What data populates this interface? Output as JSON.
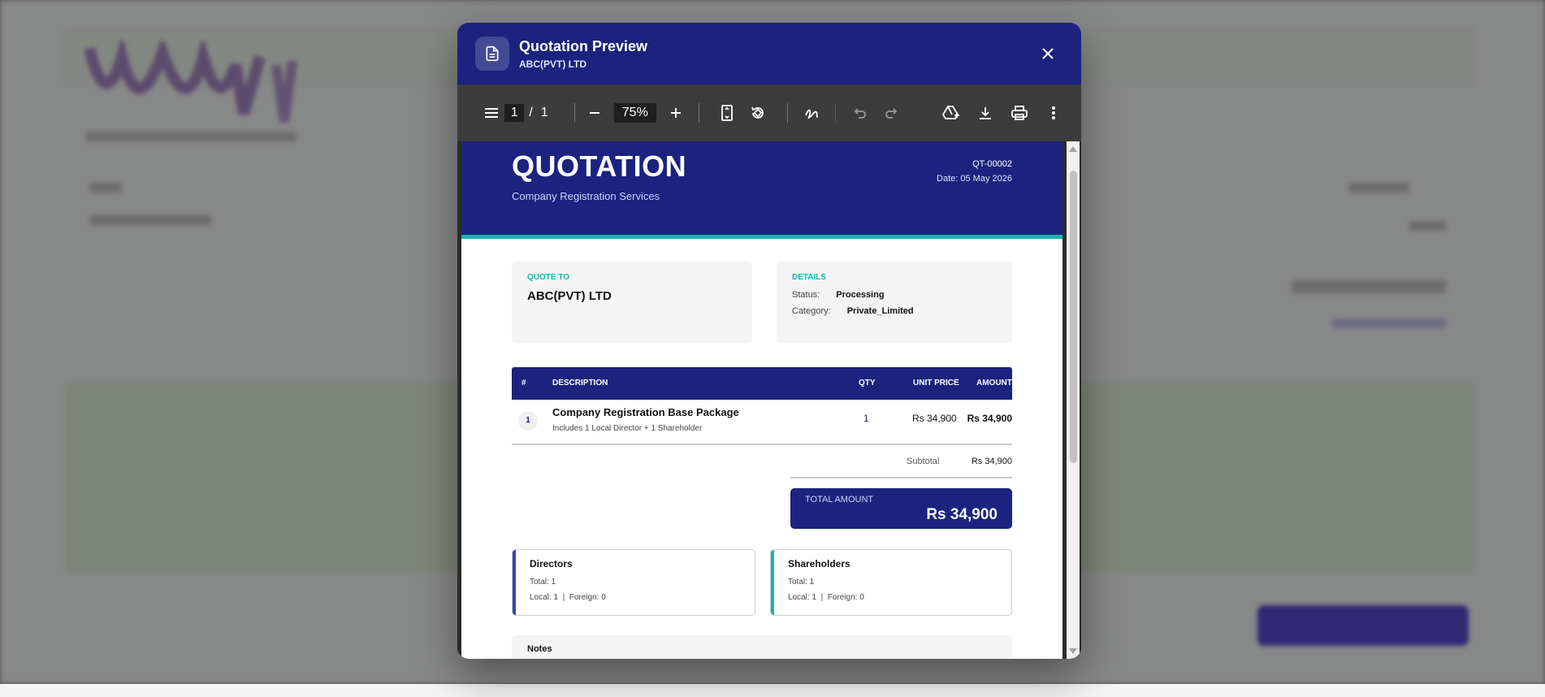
{
  "modal": {
    "title": "Quotation Preview",
    "subtitle": "ABC(PVT) LTD"
  },
  "toolbar": {
    "page_current": "1",
    "page_separator": "/",
    "page_total": "1",
    "zoom": "75%"
  },
  "document": {
    "title": "QUOTATION",
    "subtitle": "Company Registration Services",
    "number": "QT-00002",
    "date": "Date: 05 May 2026",
    "quote_to": {
      "label": "QUOTE TO",
      "company": "ABC(PVT) LTD"
    },
    "details": {
      "label": "DETAILS",
      "status_label": "Status:",
      "status_value": "Processing",
      "category_label": "Category:",
      "category_value": "Private_Limited"
    },
    "table": {
      "headers": {
        "num": "#",
        "description": "DESCRIPTION",
        "qty": "QTY",
        "unit_price": "UNIT PRICE",
        "amount": "AMOUNT"
      },
      "rows": [
        {
          "num": "1",
          "name": "Company Registration Base Package",
          "desc": "Includes 1 Local Director + 1 Shareholder",
          "qty": "1",
          "unit_price": "Rs 34,900",
          "amount": "Rs 34,900"
        }
      ]
    },
    "subtotal_label": "Subtotal",
    "subtotal_value": "Rs 34,900",
    "total_label": "TOTAL AMOUNT",
    "total_value": "Rs 34,900",
    "directors": {
      "title": "Directors",
      "total": "Total: 1",
      "breakdown": "Local: 1  |  Foreign: 0"
    },
    "shareholders": {
      "title": "Shareholders",
      "total": "Total: 1",
      "breakdown": "Local: 1  |  Foreign: 0"
    },
    "notes_title": "Notes"
  },
  "colors": {
    "primary": "#1b237e",
    "accent": "#1bb3b0",
    "directors_bar": "#3447b8",
    "shareholders_bar": "#1bb3b0"
  },
  "icons": {
    "header": "document-icon",
    "close": "close-icon",
    "sidebar": "menu-icon",
    "zoom_out": "minus-icon",
    "zoom_in": "plus-icon",
    "fit": "fit-page-icon",
    "rotate": "rotate-icon",
    "annotate": "draw-icon",
    "undo": "undo-icon",
    "redo": "redo-icon",
    "drive": "save-to-drive-icon",
    "download": "download-icon",
    "print": "print-icon",
    "more": "more-vertical-icon"
  }
}
